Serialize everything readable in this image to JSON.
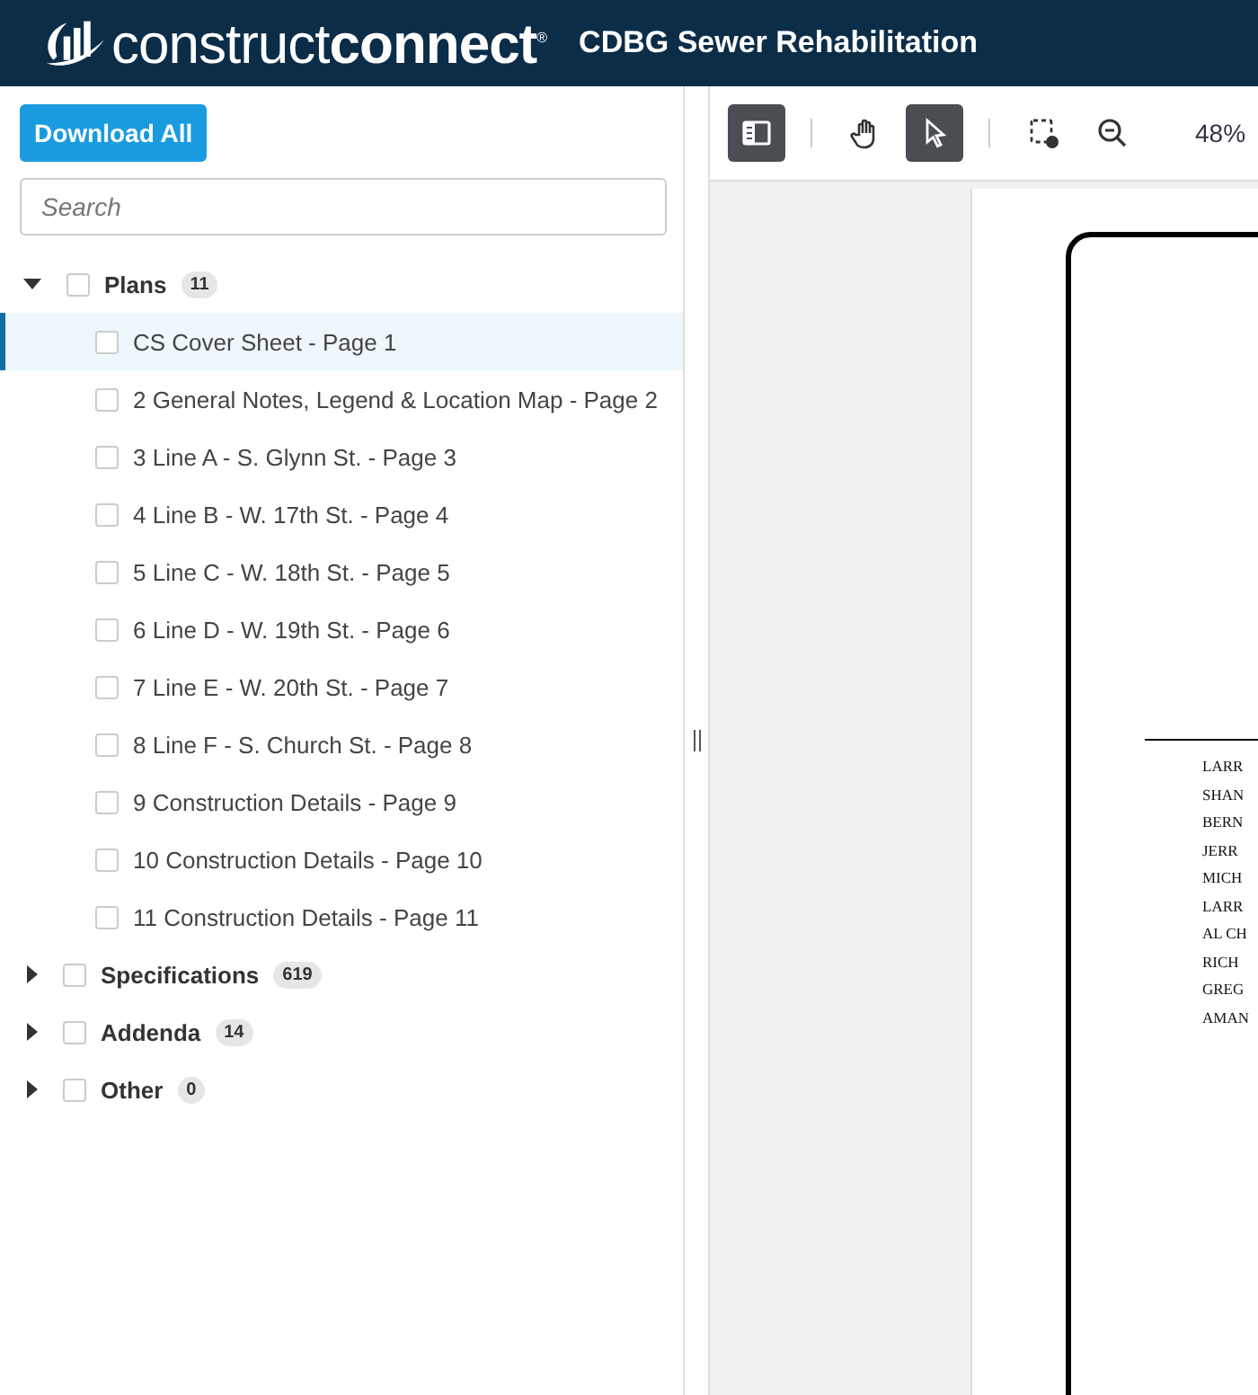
{
  "header": {
    "logo": "construct**connect**$^{®}$",
    "title": "CDBG Sewer Rehabilitation"
  },
  "sidebar": {
    "download_button": "Download All",
    "search": {
      "placeholder": "Search"
    },
    "groups": [
      {
        "label": "Plans",
        "count": "11",
        "expanded": true,
        "checked": false,
        "children": [
          {
            "label": "CS Cover Sheet - Page 1",
            "selected": true,
            "checked": false
          },
          {
            "label": "2 General Notes, Legend & Location Map - Page 2",
            "selected": false,
            "checked": false
          },
          {
            "label": "3 Line A - S. Glynn St. - Page 3",
            "selected": false,
            "checked": false
          },
          {
            "label": "4 Line B - W. 17th St. - Page 4",
            "selected": false,
            "checked": false
          },
          {
            "label": "5 Line C - W. 18th St. - Page 5",
            "selected": false,
            "checked": false
          },
          {
            "label": "6 Line D - W. 19th St. - Page 6",
            "selected": false,
            "checked": false
          },
          {
            "label": "7 Line E - W. 20th St. - Page 7",
            "selected": false,
            "checked": false
          },
          {
            "label": "8 Line F - S. Church St. - Page 8",
            "selected": false,
            "checked": false
          },
          {
            "label": "9 Construction Details - Page 9",
            "selected": false,
            "checked": false
          },
          {
            "label": "10 Construction Details - Page 10",
            "selected": false,
            "checked": false
          },
          {
            "label": "11 Construction Details - Page 11",
            "selected": false,
            "checked": false
          }
        ]
      },
      {
        "label": "Specifications",
        "count": "619",
        "expanded": false,
        "checked": false
      },
      {
        "label": "Addenda",
        "count": "14",
        "expanded": false,
        "checked": false
      },
      {
        "label": "Other",
        "count": "0",
        "expanded": false,
        "checked": false
      }
    ]
  },
  "toolbar": {
    "tools": [
      {
        "kind": "panel",
        "selected": true
      },
      {
        "kind": "divider"
      },
      {
        "kind": "pan",
        "selected": false
      },
      {
        "kind": "select",
        "selected": true
      },
      {
        "kind": "divider"
      },
      {
        "kind": "area",
        "selected": false
      },
      {
        "kind": "zoom-out",
        "selected": false
      }
    ],
    "zoom": "48%"
  },
  "document": {
    "names": [
      "LARR",
      "SHAN",
      "BERN",
      "JERR",
      "MICH",
      "LARR",
      "AL CH",
      "RICH",
      "GREG",
      "AMAN"
    ]
  }
}
